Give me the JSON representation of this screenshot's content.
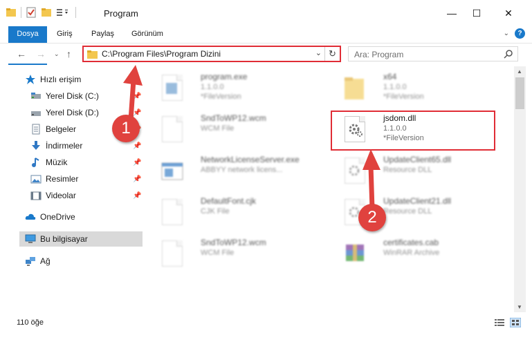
{
  "window": {
    "title": "Program",
    "controls": {
      "minimize": "—",
      "maximize": "☐",
      "close": "✕"
    }
  },
  "ribbon": {
    "tabs": [
      "Dosya",
      "Giriş",
      "Paylaş",
      "Görünüm"
    ],
    "help": "?"
  },
  "address": {
    "path": "C:\\Program Files\\Program Dizini",
    "search_placeholder": "Ara: Program"
  },
  "sidebar": {
    "quick_access": "Hızlı erişim",
    "items": [
      {
        "label": "Yerel Disk (C:)",
        "pinned": true,
        "icon": "drive-icon"
      },
      {
        "label": "Yerel Disk (D:)",
        "pinned": true,
        "icon": "drive-icon"
      },
      {
        "label": "Belgeler",
        "pinned": true,
        "icon": "documents-icon"
      },
      {
        "label": "İndirmeler",
        "pinned": true,
        "icon": "download-icon"
      },
      {
        "label": "Müzik",
        "pinned": true,
        "icon": "music-icon"
      },
      {
        "label": "Resimler",
        "pinned": true,
        "icon": "pictures-icon"
      },
      {
        "label": "Videolar",
        "pinned": true,
        "icon": "videos-icon"
      }
    ],
    "onedrive": "OneDrive",
    "this_pc": "Bu bilgisayar",
    "network": "Ağ"
  },
  "files": [
    {
      "name": "program.exe",
      "line2": "1.1.0.0",
      "line3": "*FileVersion",
      "kind": "exe"
    },
    {
      "name": "x64",
      "line2": "1.1.0.0",
      "line3": "*FileVersion",
      "kind": "folder"
    },
    {
      "name": "SndToWP12.wcm",
      "line2": "WCM File",
      "line3": "",
      "kind": "doc"
    },
    {
      "name": "jsdom.dll",
      "line2": "1.1.0.0",
      "line3": "*FileVersion",
      "kind": "dll"
    },
    {
      "name": "NetworkLicenseServer.exe",
      "line2": "ABBYY network licens...",
      "line3": "",
      "kind": "app"
    },
    {
      "name": "UpdateClient65.dll",
      "line2": "Resource DLL",
      "line3": "",
      "kind": "dll"
    },
    {
      "name": "DefaultFont.cjk",
      "line2": "CJK File",
      "line3": "",
      "kind": "doc"
    },
    {
      "name": "UpdateClient21.dll",
      "line2": "Resource DLL",
      "line3": "",
      "kind": "dll"
    },
    {
      "name": "SndToWP12.wcm",
      "line2": "WCM File",
      "line3": "",
      "kind": "doc"
    },
    {
      "name": "certificates.cab",
      "line2": "WinRAR Archive",
      "line3": "",
      "kind": "archive"
    }
  ],
  "status": {
    "item_count": "110 öğe"
  },
  "annotations": {
    "callout1": "1",
    "callout2": "2"
  },
  "colors": {
    "accent": "#1979ca",
    "highlight": "#e02c35",
    "callout": "#e0423e"
  }
}
